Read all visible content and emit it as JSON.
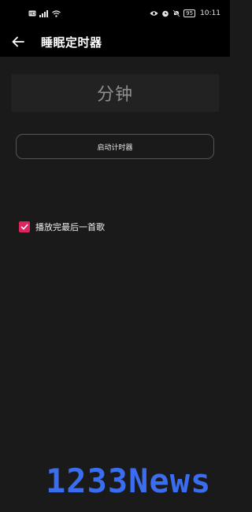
{
  "status_bar": {
    "left_icons": [
      "hd-icon",
      "signal-icon",
      "wifi-icon"
    ],
    "right_icons": [
      "eye-icon",
      "alarm-icon",
      "mute-icon"
    ],
    "battery": "95",
    "time": "10:11"
  },
  "app_bar": {
    "title": "睡眠定时器"
  },
  "timer": {
    "minutes_label": "分钟"
  },
  "start_button": {
    "label": "启动计时器"
  },
  "option": {
    "label": "播放完最后一首歌",
    "checked": true,
    "accent_color": "#e0245e"
  },
  "watermark": {
    "text": "1233News"
  }
}
